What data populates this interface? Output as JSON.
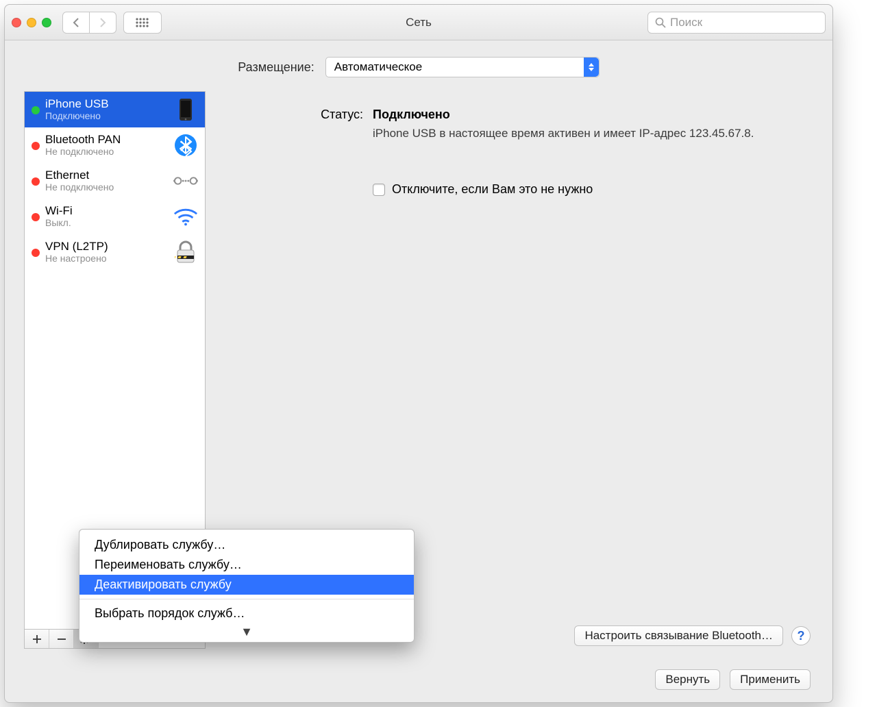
{
  "window": {
    "title": "Сеть"
  },
  "search": {
    "placeholder": "Поиск"
  },
  "location": {
    "label": "Размещение:",
    "value": "Автоматическое"
  },
  "services": [
    {
      "name": "iPhone USB",
      "status": "Подключено",
      "dot": "green",
      "icon": "iphone",
      "selected": true
    },
    {
      "name": "Bluetooth PAN",
      "status": "Не подключено",
      "dot": "red",
      "icon": "bluetooth"
    },
    {
      "name": "Ethernet",
      "status": "Не подключено",
      "dot": "red",
      "icon": "ethernet"
    },
    {
      "name": "Wi-Fi",
      "status": "Выкл.",
      "dot": "red",
      "icon": "wifi"
    },
    {
      "name": "VPN (L2TP)",
      "status": "Не настроено",
      "dot": "red",
      "icon": "vpn"
    }
  ],
  "details": {
    "status_label": "Статус:",
    "status_value": "Подключено",
    "status_desc": "iPhone USB  в настоящее время активен и имеет IP-адрес 123.45.67.8.",
    "disable_hint": "Отключите, если Вам это не нужно",
    "config_button": "Настроить связывание Bluetooth…"
  },
  "footer": {
    "revert": "Вернуть",
    "apply": "Применить"
  },
  "gear_menu": {
    "items": [
      "Дублировать службу…",
      "Переименовать службу…",
      "Деактивировать службу",
      "__sep__",
      "Выбрать порядок служб…"
    ],
    "highlighted_index": 2
  }
}
